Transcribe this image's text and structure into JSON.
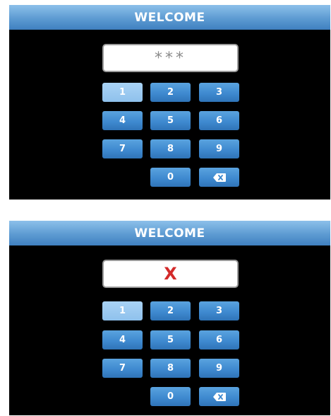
{
  "screens": [
    {
      "title": "WELCOME",
      "display_text": "***",
      "display_state": "masked",
      "keys": [
        "1",
        "2",
        "3",
        "4",
        "5",
        "6",
        "7",
        "8",
        "9",
        "0"
      ],
      "backspace_icon": "backspace-icon",
      "active_key": "1"
    },
    {
      "title": "WELCOME",
      "display_text": "X",
      "display_state": "error",
      "keys": [
        "1",
        "2",
        "3",
        "4",
        "5",
        "6",
        "7",
        "8",
        "9",
        "0"
      ],
      "backspace_icon": "backspace-icon",
      "active_key": "1"
    }
  ],
  "colors": {
    "titlebar": "#5d9bd2",
    "key": "#3f8ad0",
    "key_active": "#a9d3f5",
    "error_text": "#d32a2a",
    "masked_text": "#8a8a8a"
  }
}
